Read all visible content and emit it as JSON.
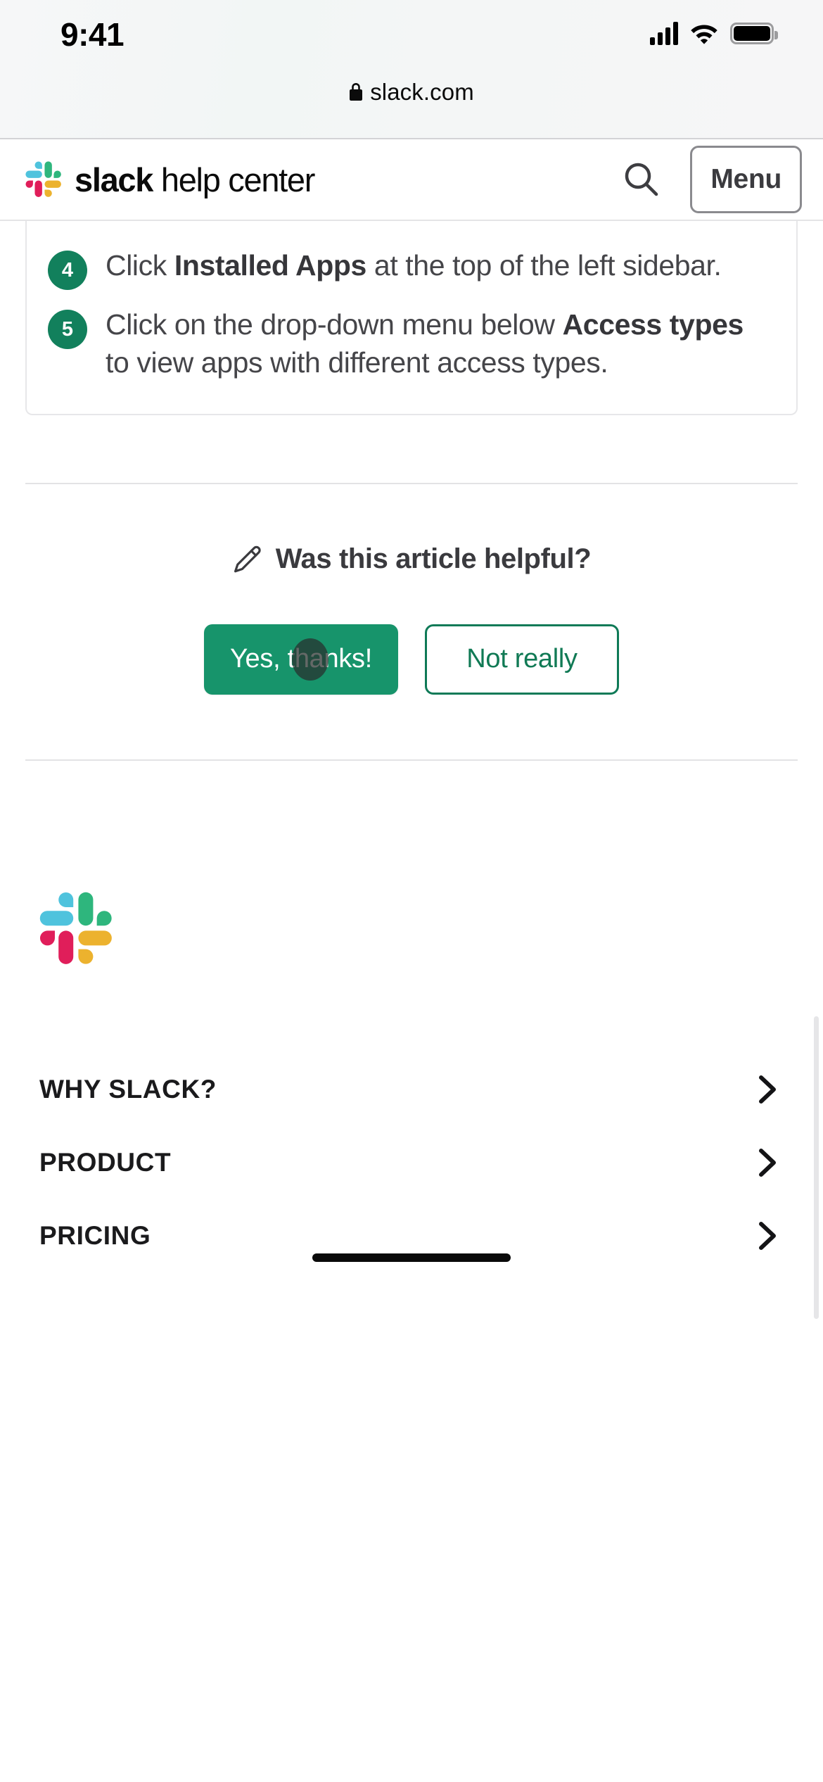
{
  "status_bar": {
    "time": "9:41",
    "signal_icon": "cellular-signal-icon",
    "wifi_icon": "wifi-icon",
    "battery_icon": "battery-icon"
  },
  "browser": {
    "lock_icon": "lock-icon",
    "host": "slack.com"
  },
  "header": {
    "logo_icon": "slack-hash-logo-icon",
    "brand_bold": "slack",
    "brand_light": " help center",
    "search_icon": "search-icon",
    "menu_label": "Menu"
  },
  "article": {
    "steps": [
      {
        "number": "4",
        "parts": [
          {
            "text": "Click ",
            "bold": false
          },
          {
            "text": "Installed Apps",
            "bold": true
          },
          {
            "text": " at the top of the left sidebar.",
            "bold": false
          }
        ]
      },
      {
        "number": "5",
        "parts": [
          {
            "text": "Click on the drop-down menu below ",
            "bold": false
          },
          {
            "text": "Access types",
            "bold": true
          },
          {
            "text": " to view apps with different access types.",
            "bold": false
          }
        ]
      }
    ]
  },
  "feedback": {
    "pencil_icon": "pencil-icon",
    "question": "Was this article helpful?",
    "yes_label": "Yes, thanks!",
    "no_label": "Not really",
    "touch_indicator": "touch-point-indicator"
  },
  "footer": {
    "logo_icon": "slack-hash-logo-icon",
    "links": [
      {
        "label": "WHY SLACK?",
        "chevron": "chevron-right-icon"
      },
      {
        "label": "PRODUCT",
        "chevron": "chevron-right-icon"
      },
      {
        "label": "PRICING",
        "chevron": "chevron-right-icon"
      }
    ]
  },
  "colors": {
    "slack_green": "#17946b",
    "bullet_green": "#12805c",
    "outline_green": "#0f7a57",
    "logo_blue": "#4fc3dd",
    "logo_green": "#2eb67d",
    "logo_red": "#e01e5a",
    "logo_yellow": "#ecb22e",
    "body_text": "#454549"
  },
  "home_indicator": "home-indicator"
}
